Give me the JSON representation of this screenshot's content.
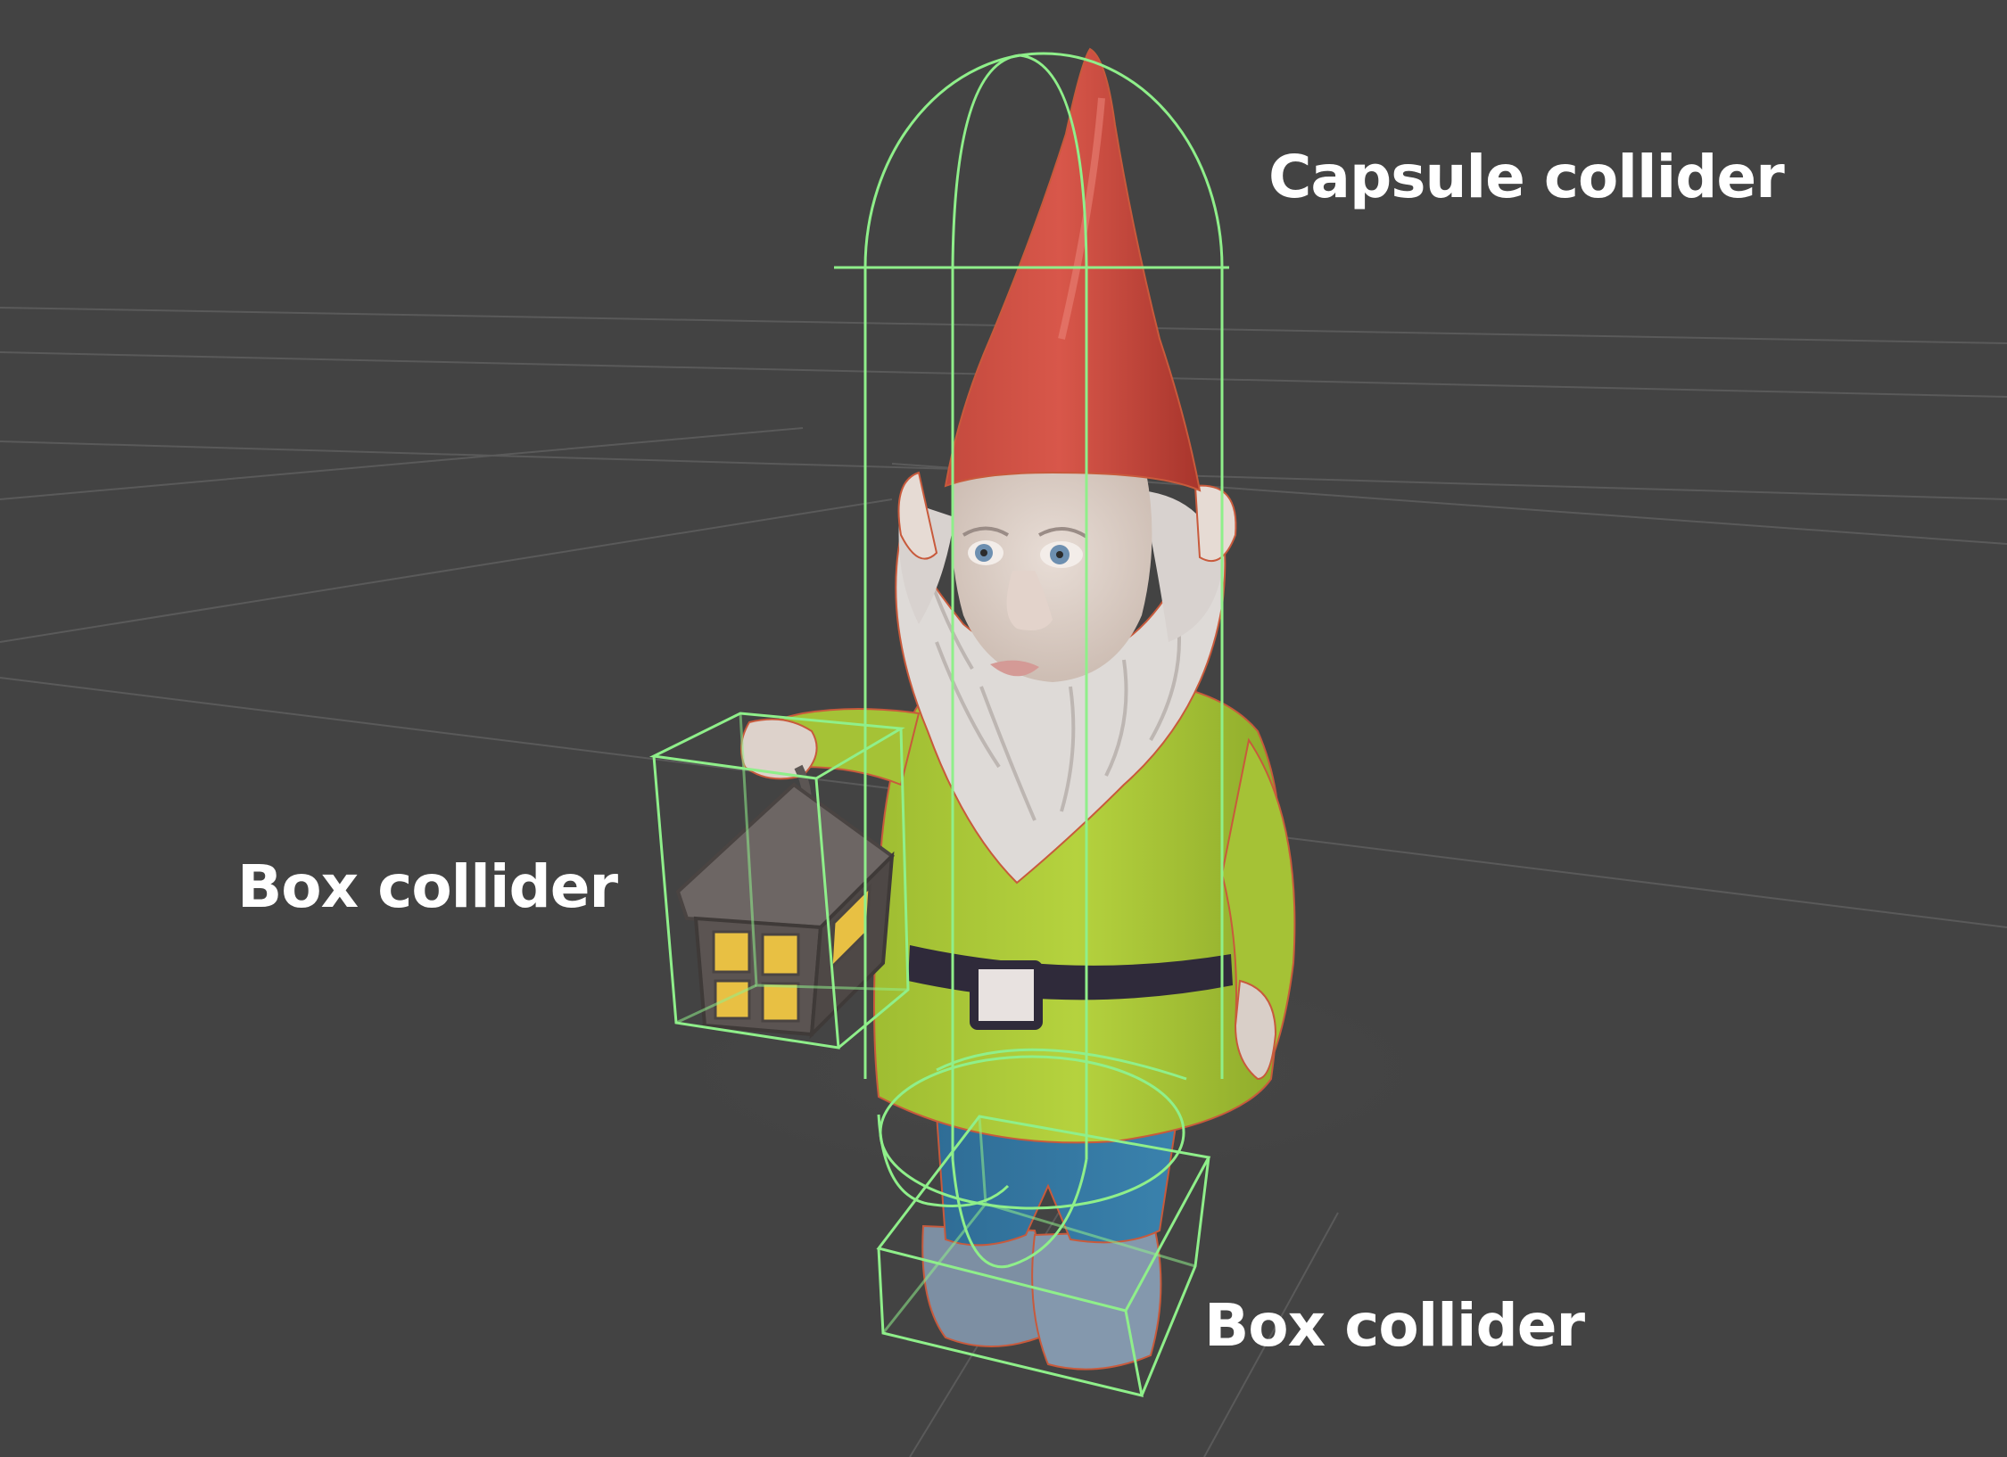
{
  "scene": {
    "background_color": "#434343",
    "grid_color": "#5a5a5a",
    "collider_color": "#8fef8a"
  },
  "labels": {
    "capsule": "Capsule collider",
    "box_lantern": "Box collider",
    "box_feet": "Box collider"
  }
}
